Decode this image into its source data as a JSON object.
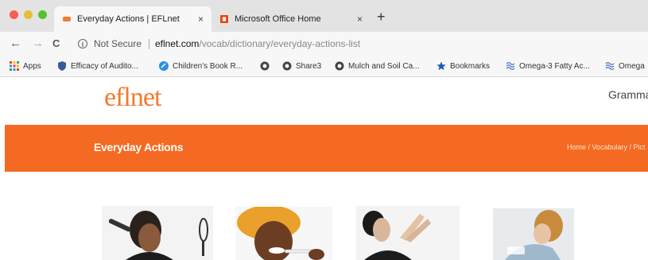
{
  "browser": {
    "tabs": [
      {
        "title": "Everyday Actions | EFLnet",
        "close": "×",
        "active": true
      },
      {
        "title": "Microsoft Office Home",
        "close": "×",
        "active": false
      }
    ],
    "new_tab": "+",
    "nav": {
      "back": "←",
      "forward": "→",
      "reload": "C"
    },
    "security_label": "Not Secure",
    "url_host": "eflnet.com",
    "url_path": "/vocab/dictionary/everyday-actions-list",
    "bookmarks": [
      {
        "label": "Apps",
        "icon": "apps-grid-icon"
      },
      {
        "label": "Efficacy of Audito...",
        "icon": "shield-icon"
      },
      {
        "label": "Children's Book R...",
        "icon": "blue-circle-icon"
      },
      {
        "label": "",
        "icon": "globe-icon"
      },
      {
        "label": "Share3",
        "icon": "globe-icon"
      },
      {
        "label": "Mulch and Soil Ca...",
        "icon": "globe-icon"
      },
      {
        "label": "Bookmarks",
        "icon": "star-icon"
      },
      {
        "label": "Omega-3 Fatty Ac...",
        "icon": "wave-icon"
      },
      {
        "label": "Omega",
        "icon": "wave-icon"
      }
    ]
  },
  "site": {
    "logo": "eflnet",
    "nav_grammar": "Grammar",
    "banner_title": "Everyday Actions",
    "breadcrumb": "Home / Vocabulary / Pict"
  },
  "colors": {
    "brand_orange": "#f56a22",
    "logo_orange": "#f47a2e"
  }
}
